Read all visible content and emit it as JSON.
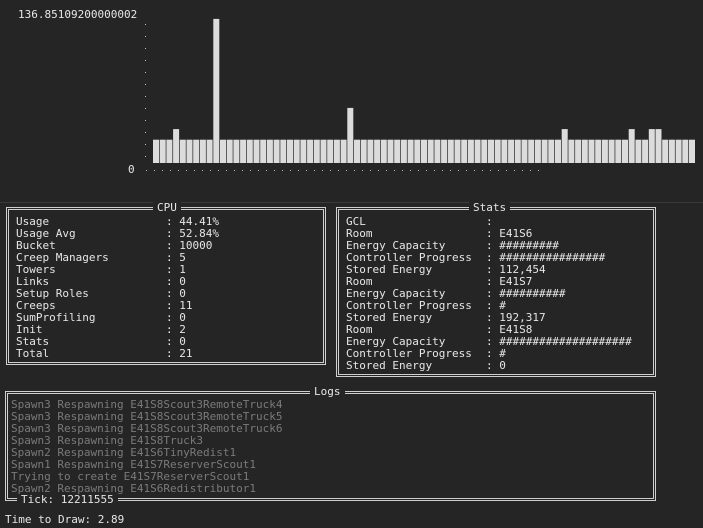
{
  "chart_data": {
    "type": "bar",
    "ymax_label": "136.85109200000002",
    "ymin_label": "0",
    "ylim": [
      0,
      136.85109200000002
    ],
    "values": [
      22,
      22,
      22,
      32,
      22,
      22,
      22,
      22,
      22,
      136,
      22,
      22,
      22,
      22,
      22,
      22,
      22,
      22,
      22,
      22,
      22,
      22,
      22,
      22,
      22,
      22,
      22,
      22,
      22,
      52,
      22,
      22,
      22,
      22,
      22,
      22,
      22,
      22,
      22,
      22,
      22,
      22,
      22,
      22,
      22,
      22,
      22,
      22,
      22,
      22,
      22,
      22,
      22,
      22,
      22,
      22,
      22,
      22,
      22,
      22,
      22,
      32,
      22,
      22,
      22,
      22,
      22,
      22,
      22,
      22,
      22,
      32,
      22,
      22,
      32,
      32,
      22,
      22,
      22,
      22,
      22
    ]
  },
  "cpu": {
    "title": "CPU",
    "rows": [
      {
        "key": "Usage",
        "value": "44.41%"
      },
      {
        "key": "Usage Avg",
        "value": "52.84%"
      },
      {
        "key": "Bucket",
        "value": "10000"
      },
      {
        "key": "Creep Managers",
        "value": "5"
      },
      {
        "key": "Towers",
        "value": "1"
      },
      {
        "key": "Links",
        "value": "0"
      },
      {
        "key": "Setup Roles",
        "value": "0"
      },
      {
        "key": "Creeps",
        "value": "11"
      },
      {
        "key": "SumProfiling",
        "value": "0"
      },
      {
        "key": "Init",
        "value": "2"
      },
      {
        "key": "Stats",
        "value": "0"
      },
      {
        "key": "Total",
        "value": "21"
      }
    ]
  },
  "stats": {
    "title": "Stats",
    "rows": [
      {
        "key": "GCL",
        "value": ""
      },
      {
        "key": "Room",
        "value": "E41S6"
      },
      {
        "key": "Energy Capacity",
        "value": "#########"
      },
      {
        "key": "Controller Progress",
        "value": "################"
      },
      {
        "key": "Stored Energy",
        "value": "112,454"
      },
      {
        "key": "Room",
        "value": "E41S7"
      },
      {
        "key": "Energy Capacity",
        "value": "##########"
      },
      {
        "key": "Controller Progress",
        "value": "#"
      },
      {
        "key": "Stored Energy",
        "value": "192,317"
      },
      {
        "key": "Room",
        "value": "E41S8"
      },
      {
        "key": "Energy Capacity",
        "value": "####################"
      },
      {
        "key": "Controller Progress",
        "value": "#"
      },
      {
        "key": "Stored Energy",
        "value": "0"
      }
    ]
  },
  "logs": {
    "title": "Logs",
    "lines": [
      "Spawn3 Respawning E41S8Scout3RemoteTruck4",
      "Spawn3 Respawning E41S8Scout3RemoteTruck5",
      "Spawn3 Respawning E41S8Scout3RemoteTruck6",
      "Spawn3 Respawning E41S8Truck3",
      "Spawn2 Respawning E41S6TinyRedist1",
      "Spawn1 Respawning E41S7ReserverScout1",
      "Trying to create E41S7ReserverScout1",
      "Spawn2 Respawning E41S6Redistributor1"
    ],
    "tick_label": "Tick: 12211555"
  },
  "footer": {
    "draw_time": "Time to Draw: 2.89"
  }
}
